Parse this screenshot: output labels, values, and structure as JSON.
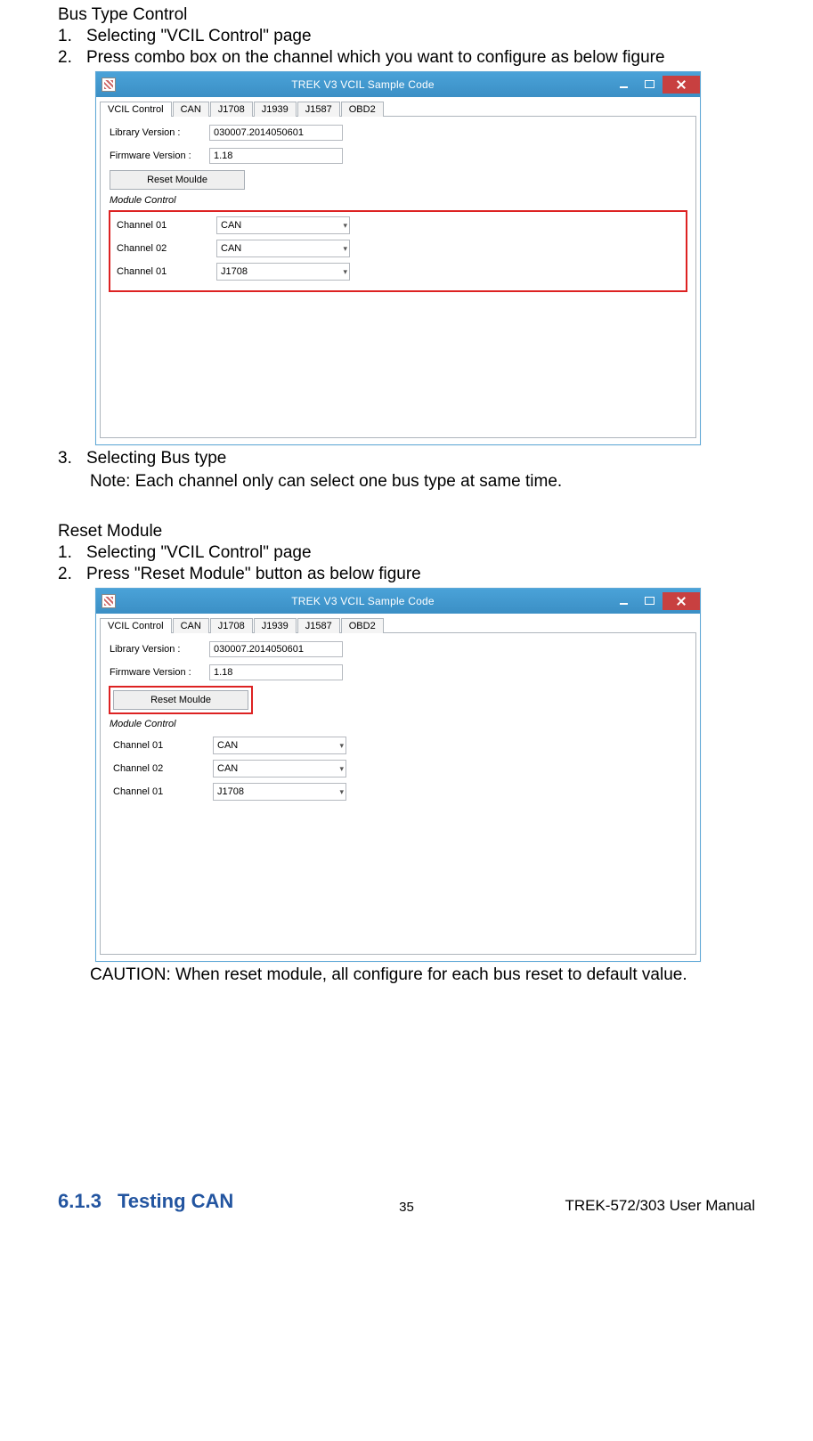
{
  "section_a": {
    "title": "Bus Type Control",
    "items": [
      "Selecting \"VCIL Control\" page",
      "Press combo box on the channel which you want to configure as below figure"
    ],
    "after_img": "Selecting Bus type",
    "note": "Note: Each channel only can select one bus type at same time."
  },
  "section_b": {
    "title": "Reset Module",
    "items": [
      "Selecting \"VCIL Control\" page",
      "Press \"Reset Module\" button as below figure"
    ],
    "caution": "CAUTION: When reset module, all configure for each bus reset to default value."
  },
  "window": {
    "title": "TREK V3 VCIL Sample Code",
    "tabs": [
      "VCIL Control",
      "CAN",
      "J1708",
      "J1939",
      "J1587",
      "OBD2"
    ],
    "lib_label": "Library Version :",
    "lib_value": "030007.2014050601",
    "fw_label": "Firmware Version :",
    "fw_value": "1.18",
    "reset_btn": "Reset Moulde",
    "group": "Module Control",
    "channels": [
      {
        "label": "Channel 01",
        "value": "CAN"
      },
      {
        "label": "Channel 02",
        "value": "CAN"
      },
      {
        "label": "Channel 01",
        "value": "J1708"
      }
    ]
  },
  "footer": {
    "secnum": "6.1.3",
    "sectitle": "Testing CAN",
    "pagenum": "35",
    "ref": "TREK-572/303 User Manual"
  }
}
